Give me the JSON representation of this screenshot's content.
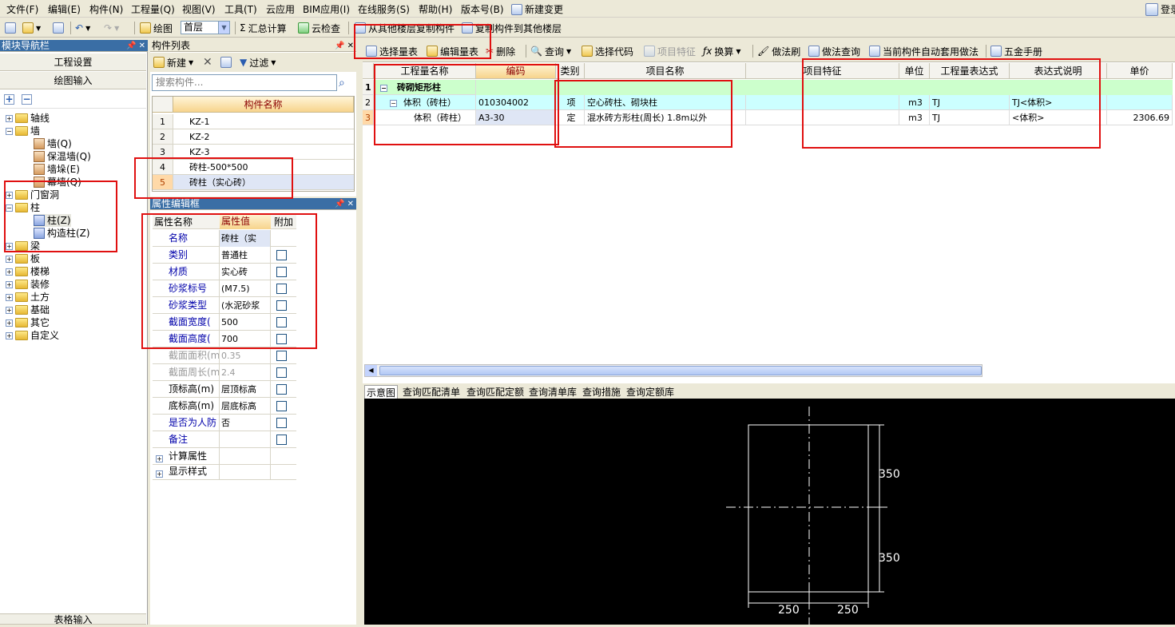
{
  "menubar": {
    "items": [
      "文件(F)",
      "编辑(E)",
      "构件(N)",
      "工程量(Q)",
      "视图(V)",
      "工具(T)",
      "云应用",
      "BIM应用(I)",
      "在线服务(S)",
      "帮助(H)",
      "版本号(B)",
      "新建变更"
    ],
    "login": "登录"
  },
  "toolbar1": {
    "draw": "绘图",
    "floor": "首层",
    "summary": "汇总计算",
    "cloud_check": "云检查",
    "copy_from": "从其他楼层复制构件",
    "copy_to": "复制构件到其他楼层"
  },
  "nav": {
    "title": "模块导航栏",
    "btn_project": "工程设置",
    "btn_draw": "绘图输入",
    "btn_table": "表格输入",
    "tree": [
      {
        "label": "轴线",
        "level": 0,
        "expanded": false
      },
      {
        "label": "墙",
        "level": 0,
        "expanded": true
      },
      {
        "label": "墙(Q)",
        "level": 1
      },
      {
        "label": "保温墙(Q)",
        "level": 1
      },
      {
        "label": "墙垛(E)",
        "level": 1
      },
      {
        "label": "幕墙(Q)",
        "level": 1
      },
      {
        "label": "门窗洞",
        "level": 0,
        "expanded": false
      },
      {
        "label": "柱",
        "level": 0,
        "expanded": true
      },
      {
        "label": "柱(Z)",
        "level": 1
      },
      {
        "label": "构造柱(Z)",
        "level": 1
      },
      {
        "label": "梁",
        "level": 0,
        "expanded": false
      },
      {
        "label": "板",
        "level": 0,
        "expanded": false
      },
      {
        "label": "楼梯",
        "level": 0,
        "expanded": false
      },
      {
        "label": "装修",
        "level": 0,
        "expanded": false
      },
      {
        "label": "土方",
        "level": 0,
        "expanded": false
      },
      {
        "label": "基础",
        "level": 0,
        "expanded": false
      },
      {
        "label": "其它",
        "level": 0,
        "expanded": false
      },
      {
        "label": "自定义",
        "level": 0,
        "expanded": false
      }
    ]
  },
  "complist": {
    "title": "构件列表",
    "new_btn": "新建",
    "filter_btn": "过滤",
    "search_placeholder": "搜索构件...",
    "col_header": "构件名称",
    "rows": [
      {
        "num": "1",
        "name": "KZ-1"
      },
      {
        "num": "2",
        "name": "KZ-2"
      },
      {
        "num": "3",
        "name": "KZ-3"
      },
      {
        "num": "4",
        "name": "砖柱-500*500"
      },
      {
        "num": "5",
        "name": "砖柱（实心砖）"
      }
    ]
  },
  "propedit": {
    "title": "属性编辑框",
    "col_name": "属性名称",
    "col_value": "属性值",
    "col_extra": "附加",
    "rows": [
      {
        "name": "名称",
        "value": "砖柱（实"
      },
      {
        "name": "类别",
        "value": "普通柱"
      },
      {
        "name": "材质",
        "value": "实心砖"
      },
      {
        "name": "砂浆标号",
        "value": "(M7.5)"
      },
      {
        "name": "砂浆类型",
        "value": "(水泥砂浆"
      },
      {
        "name": "截面宽度(",
        "value": "500"
      },
      {
        "name": "截面高度(",
        "value": "700"
      },
      {
        "name": "截面面积(m",
        "value": "0.35"
      },
      {
        "name": "截面周长(m",
        "value": "2.4"
      },
      {
        "name": "顶标高(m)",
        "value": "层顶标高"
      },
      {
        "name": "底标高(m)",
        "value": "层底标高"
      },
      {
        "name": "是否为人防",
        "value": "否"
      },
      {
        "name": "备注",
        "value": ""
      }
    ],
    "group_calc": "计算属性",
    "group_display": "显示样式"
  },
  "maintoolbar": {
    "select_qty": "选择量表",
    "edit_qty": "编辑量表",
    "delete": "删除",
    "query": "查询",
    "select_code": "选择代码",
    "item_feature": "项目特征",
    "convert": "换算",
    "method_brush": "做法刷",
    "method_query": "做法查询",
    "auto_apply": "当前构件自动套用做法",
    "handbook": "五金手册"
  },
  "table": {
    "headers": [
      "工程量名称",
      "编码",
      "类别",
      "项目名称",
      "项目特征",
      "单位",
      "工程量表达式",
      "表达式说明",
      "单价"
    ],
    "rows": [
      {
        "num": "1",
        "name": "砖砌矩形柱",
        "code": "",
        "type": "",
        "project": "",
        "feature": "",
        "unit": "",
        "expr": "",
        "desc": "",
        "price": ""
      },
      {
        "num": "2",
        "name": "体积（砖柱）",
        "code": "010304002",
        "type": "项",
        "project": "空心砖柱、砌块柱",
        "feature": "",
        "unit": "m3",
        "expr": "TJ",
        "desc": "TJ<体积>",
        "price": ""
      },
      {
        "num": "3",
        "name": "体积（砖柱）",
        "code": "A3-30",
        "type": "定",
        "project": "混水砖方形柱(周长) 1.8m以外",
        "feature": "",
        "unit": "m3",
        "expr": "TJ",
        "desc": "<体积>",
        "price": "2306.69"
      }
    ]
  },
  "diagtabs": {
    "items": [
      "示意图",
      "查询匹配清单",
      "查询匹配定额",
      "查询清单库",
      "查询措施",
      "查询定额库"
    ]
  },
  "diagram": {
    "dim_top": "350",
    "dim_bottom": "350",
    "dim_left": "250",
    "dim_right": "250"
  },
  "colors": {
    "highlight_box": "#e01010",
    "group_row": "#ccffcc",
    "row_cyan": "#ccffff"
  }
}
